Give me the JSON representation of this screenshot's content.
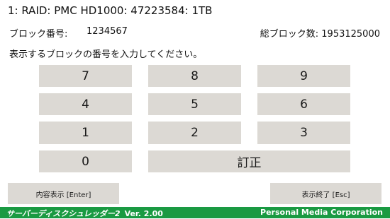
{
  "header": {
    "disk_title": "1: RAID: PMC HD1000: 47223584: 1TB",
    "block_number_label": "ブロック番号:",
    "block_number_value": "1234567",
    "total_blocks": "総ブロック数: 1953125000",
    "instruction": "表示するブロックの番号を入力してください。"
  },
  "keypad": {
    "k7": "7",
    "k8": "8",
    "k9": "9",
    "k4": "4",
    "k5": "5",
    "k6": "6",
    "k1": "1",
    "k2": "2",
    "k3": "3",
    "k0": "0",
    "correct": "訂正"
  },
  "actions": {
    "show_content": "内容表示 [Enter]",
    "end_display": "表示終了 [Esc]"
  },
  "footer": {
    "app_name": "サーバーディスクシュレッダー2",
    "version": "Ver. 2.00",
    "company": "Personal Media Corporation",
    "background_color": "#1a9a42"
  }
}
